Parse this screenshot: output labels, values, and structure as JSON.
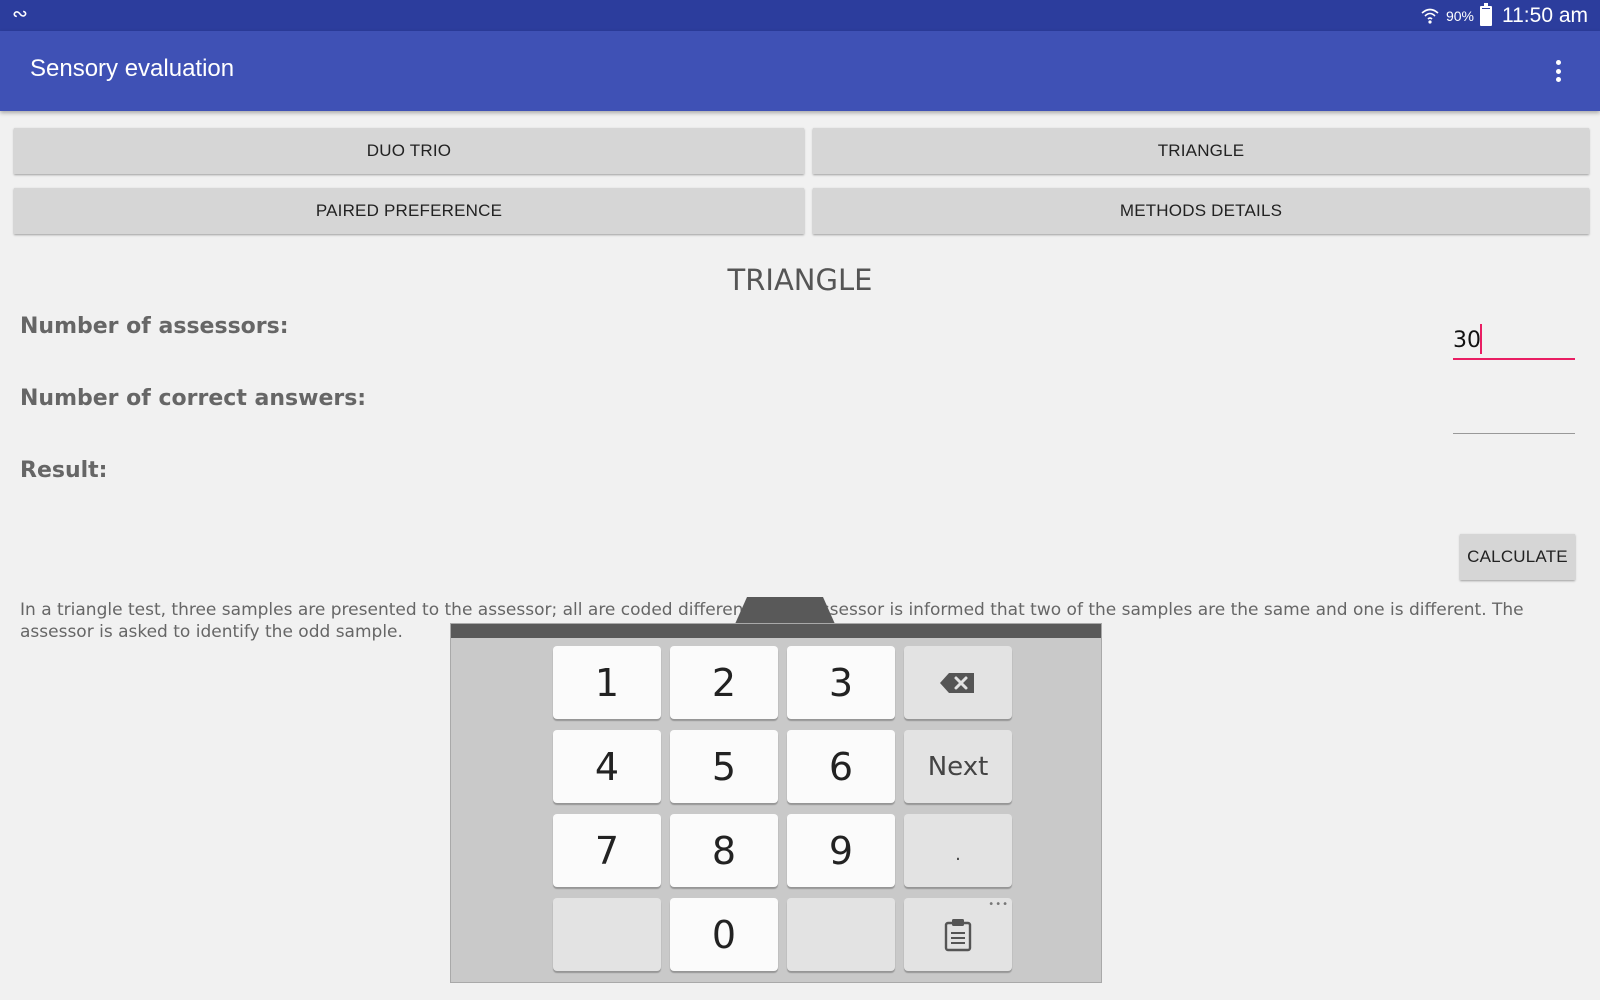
{
  "status_bar": {
    "app_icon": "app-notification-icon",
    "battery_percent": "90%",
    "time": "11:50 am"
  },
  "app_bar": {
    "title": "Sensory evaluation",
    "menu_icon": "overflow-menu-icon"
  },
  "method_buttons": {
    "duo_trio": "DUO TRIO",
    "triangle": "TRIANGLE",
    "paired_preference": "PAIRED PREFERENCE",
    "methods_details": "METHODS DETAILS"
  },
  "form": {
    "section_title": "TRIANGLE",
    "assessors_label": "Number of assessors:",
    "assessors_value": "30",
    "correct_answers_label": "Number of correct answers:",
    "correct_answers_value": "",
    "result_label": "Result:",
    "calculate_label": "CALCULATE"
  },
  "description": "In a triangle test, three samples are presented to the assessor; all are coded differently. The assessor is informed that two of the samples are the same and one is different. The assessor is asked to identify the odd sample.",
  "keyboard": {
    "row1": [
      "1",
      "2",
      "3"
    ],
    "row2": [
      "4",
      "5",
      "6"
    ],
    "row3": [
      "7",
      "8",
      "9"
    ],
    "zero": "0",
    "next_label": "Next",
    "decimal_label": ".",
    "settings_label": "•••",
    "backspace_icon": "backspace-icon",
    "clipboard_icon": "clipboard-icon"
  },
  "colors": {
    "status_bar": "#2c3d9d",
    "app_bar": "#3f51b5",
    "accent": "#e91e63",
    "background": "#f1f1f1"
  }
}
